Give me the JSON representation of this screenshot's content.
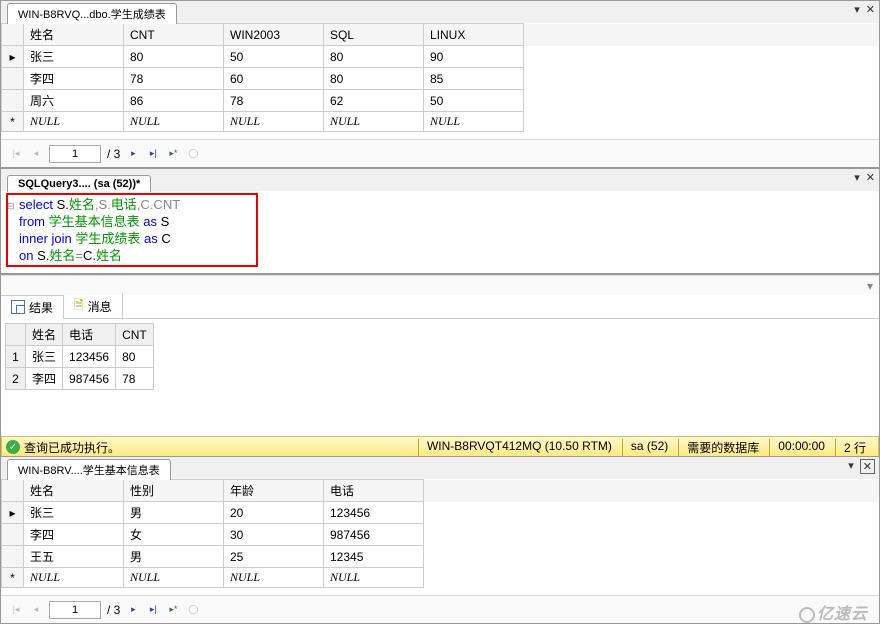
{
  "panel1": {
    "tab_title": "WIN-B8RVQ...dbo.学生成绩表",
    "columns": [
      "姓名",
      "CNT",
      "WIN2003",
      "SQL",
      "LINUX"
    ],
    "rows": [
      [
        "张三",
        "80",
        "50",
        "80",
        "90"
      ],
      [
        "李四",
        "78",
        "60",
        "80",
        "85"
      ],
      [
        "周六",
        "86",
        "78",
        "62",
        "50"
      ]
    ],
    "null_label": "NULL",
    "page_current": "1",
    "page_total": "/ 3"
  },
  "panel2": {
    "tab_title": "SQLQuery3.... (sa (52))*",
    "sql": {
      "l1a": "select",
      "l1b": " S.",
      "l1c": "姓名",
      "l1d": ",S.",
      "l1e": "电话",
      "l1f": ",C.CNT",
      "l2a": "from ",
      "l2b": "学生基本信息表",
      "l2c": " as ",
      "l2d": "S",
      "l3a": "inner join ",
      "l3b": "学生成绩表",
      "l3c": " as ",
      "l3d": "C",
      "l4a": "on ",
      "l4b": "S.",
      "l4c": "姓名",
      "l4d": "=",
      "l4e": "C.",
      "l4f": "姓名"
    }
  },
  "panel3": {
    "tab_results": "结果",
    "tab_messages": "消息",
    "columns": [
      "姓名",
      "电话",
      "CNT"
    ],
    "rows": [
      [
        "张三",
        "123456",
        "80"
      ],
      [
        "李四",
        "987456",
        "78"
      ]
    ],
    "status_msg": "查询已成功执行。",
    "status_server": "WIN-B8RVQT412MQ (10.50 RTM)",
    "status_user": "sa (52)",
    "status_db": "需要的数据库",
    "status_time": "00:00:00",
    "status_rows": "2 行"
  },
  "panel4": {
    "tab_title": "WIN-B8RV....学生基本信息表",
    "columns": [
      "姓名",
      "性别",
      "年龄",
      "电话"
    ],
    "rows": [
      [
        "张三",
        "男",
        "20",
        "123456"
      ],
      [
        "李四",
        "女",
        "30",
        "987456"
      ],
      [
        "王五",
        "男",
        "25",
        "12345"
      ]
    ],
    "null_label": "NULL",
    "page_current": "1",
    "page_total": "/ 3"
  },
  "logo_text": "亿速云"
}
